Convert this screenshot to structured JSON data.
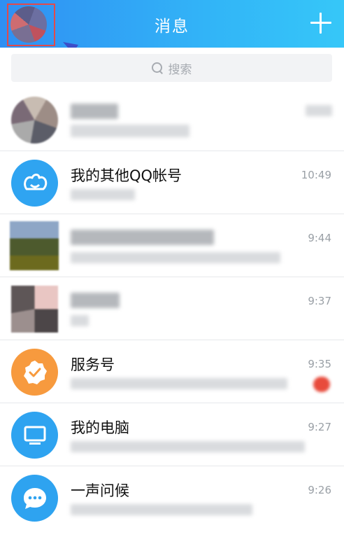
{
  "header": {
    "title": "消息",
    "plus_icon": "plus-icon",
    "accent": "#2f8ff3"
  },
  "search": {
    "placeholder": "搜索",
    "icon": "search-icon"
  },
  "conversations": [
    {
      "name": "",
      "time": "",
      "preview": "",
      "avatar": "blurred-photo",
      "redacted": true
    },
    {
      "name": "我的其他QQ帐号",
      "time": "10:49",
      "preview": "有新消息",
      "avatar": "qq-account-icon",
      "redacted_preview": true
    },
    {
      "name": "",
      "time": "9:44",
      "preview": "",
      "avatar": "blurred-photo",
      "redacted": true
    },
    {
      "name": "",
      "time": "9:37",
      "preview": "",
      "avatar": "blurred-photo",
      "redacted": true
    },
    {
      "name": "服务号",
      "time": "9:35",
      "preview": "",
      "avatar": "service-badge-icon",
      "redacted_preview": true,
      "has_unread": true
    },
    {
      "name": "我的电脑",
      "time": "9:27",
      "preview": "",
      "avatar": "monitor-icon",
      "redacted_preview": true
    },
    {
      "name": "一声问候",
      "time": "9:26",
      "preview": "",
      "avatar": "chat-bubble-icon",
      "redacted_preview": true
    }
  ],
  "colors": {
    "qq_blue": "#2fa4f1",
    "service_orange": "#f79a3e",
    "unread_red": "#e84b3c",
    "annotation_red": "#e34a4a",
    "annotation_arrow": "#3d4ec9"
  }
}
